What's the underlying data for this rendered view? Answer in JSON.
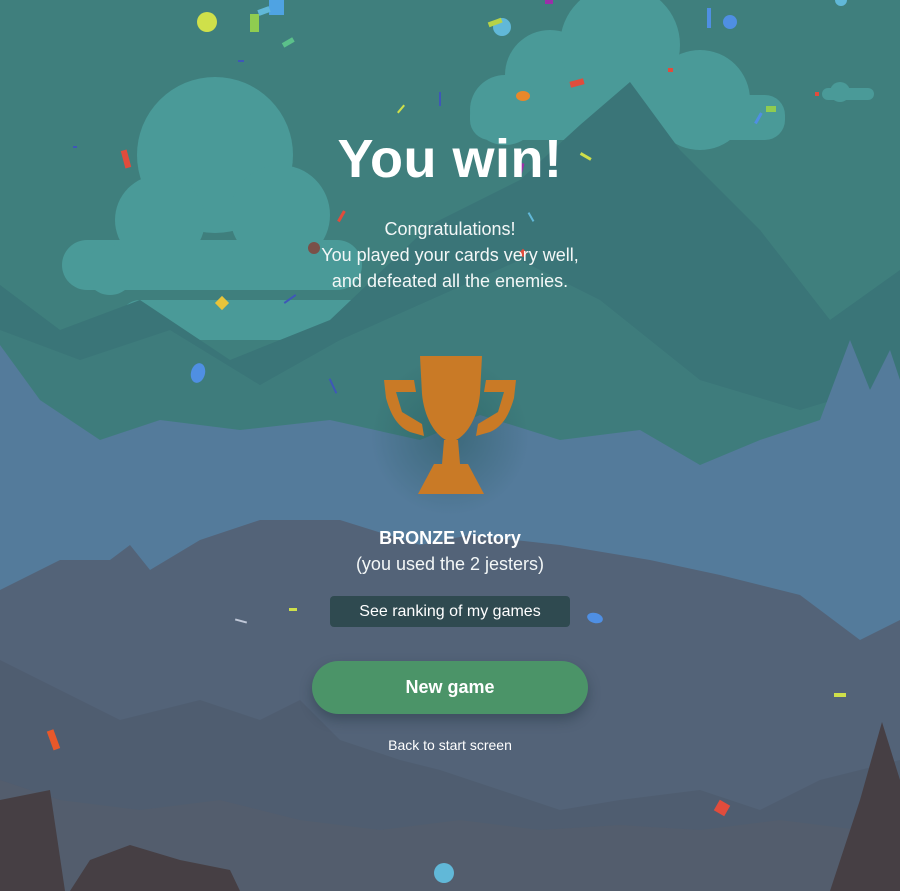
{
  "result": {
    "title": "You win!",
    "message_lines": [
      "Congratulations!",
      "You played your cards very well,",
      "and defeated all the enemies."
    ],
    "trophy_icon": "trophy-icon",
    "trophy_color": "#c97a26",
    "victory_level": "BRONZE Victory",
    "victory_detail": "(you used the 2 jesters)"
  },
  "actions": {
    "ranking_label": "See ranking of my games",
    "new_game_label": "New game",
    "back_label": "Back to start screen"
  },
  "colors": {
    "sky": "#3f7f7d",
    "cloud": "#4a9a98",
    "mountain_far": "#3a7578",
    "mountain_mid": "#547b9b",
    "mountain_low": "#536378",
    "rocks": "#463f44",
    "primary_button": "#4b9468",
    "secondary_button": "#2f4a50"
  }
}
